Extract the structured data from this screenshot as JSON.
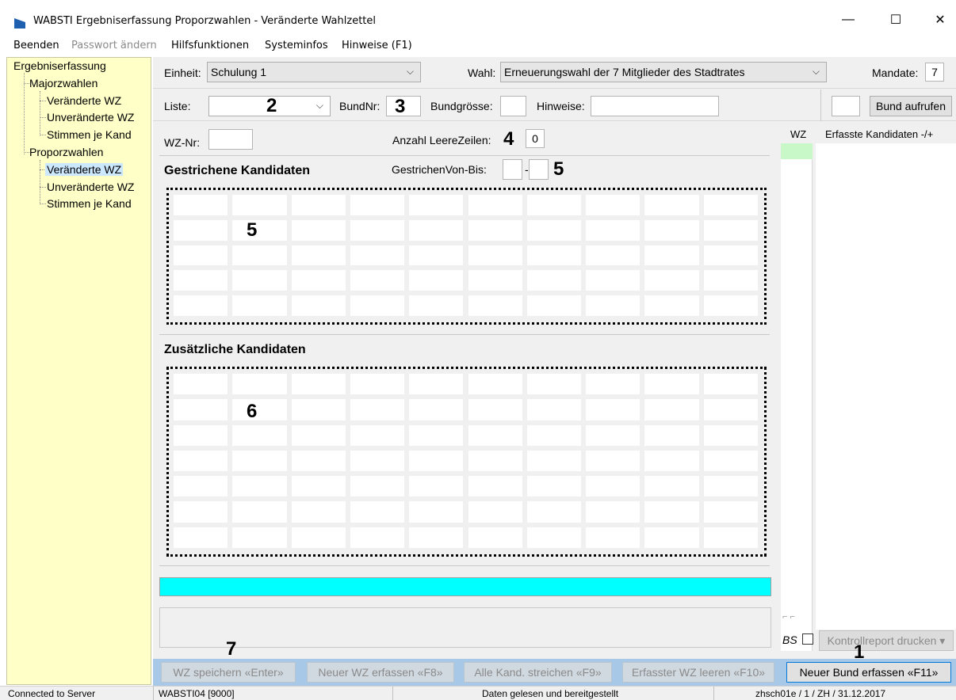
{
  "window": {
    "title": "WABSTI Ergebniserfassung Proporzwahlen - Veränderte Wahlzettel",
    "min_glyph": "—",
    "max_glyph": "☐",
    "close_glyph": "✕"
  },
  "menu": {
    "items": [
      {
        "label": "Beenden",
        "enabled": true
      },
      {
        "label": "Passwort ändern",
        "enabled": false
      },
      {
        "label": "Hilfsfunktionen",
        "enabled": true
      },
      {
        "label": "Systeminfos",
        "enabled": true
      },
      {
        "label": "Hinweise (F1)",
        "enabled": true
      }
    ]
  },
  "tree": {
    "root": "Ergebniserfassung",
    "groups": [
      {
        "label": "Majorzwahlen",
        "children": [
          "Veränderte WZ",
          "Unveränderte WZ",
          "Stimmen je Kand"
        ]
      },
      {
        "label": "Proporzwahlen",
        "children": [
          "Veränderte WZ",
          "Unveränderte WZ",
          "Stimmen je Kand"
        ],
        "selected_index": 0
      }
    ]
  },
  "header": {
    "einheit_label": "Einheit:",
    "einheit_value": "Schulung 1",
    "wahl_label": "Wahl:",
    "wahl_value": "Erneuerungswahl der 7 Mitglieder des Stadtrates",
    "mandate_label": "Mandate:",
    "mandate_value": "7"
  },
  "liste_row": {
    "liste_label": "Liste:",
    "liste_value": "",
    "bundnr_label": "BundNr:",
    "bundgroesse_label": "Bundgrösse:",
    "hinweise_label": "Hinweise:",
    "bund_aufrufen_label": "Bund aufrufen"
  },
  "wz_row": {
    "wznr_label": "WZ-Nr:",
    "anzahl_label": "Anzahl LeereZeilen:",
    "anzahl_value": "0",
    "gestrichen_von_bis_label": "GestrichenVon-Bis:",
    "von_bis_sep": "-"
  },
  "sections": {
    "gestrichene": "Gestrichene Kandidaten",
    "zusaetzliche": "Zusätzliche Kandidaten"
  },
  "annotations": {
    "a1": "1",
    "a2": "2",
    "a3": "3",
    "a4": "4",
    "a5_field": "5",
    "a5_grid": "5",
    "a6": "6",
    "a7": "7"
  },
  "right_panel": {
    "wz_header": "WZ",
    "kand_header": "Erfasste Kandidaten -/+",
    "bs_label": "BS",
    "kontrollreport_label": "Kontrollreport drucken ▾",
    "nav_glyphs": "⌐ ⌐"
  },
  "toolbar": {
    "wz_speichern": "WZ speichern «Enter»",
    "neuer_wz": "Neuer WZ erfassen «F8»",
    "alle_kand": "Alle Kand. streichen «F9»",
    "erfasster_wz": "Erfasster WZ leeren «F10»",
    "neuer_bund": "Neuer Bund erfassen «F11»"
  },
  "status": {
    "connection": "Connected to Server",
    "server": "WABSTI04 [9000]",
    "message": "Daten gelesen und bereitgestellt",
    "context": "zhsch01e / 1 / ZH / 31.12.2017"
  },
  "colors": {
    "tree_bg": "#ffffc8",
    "progress": "#00ffff",
    "toolbar_bg": "#a8c8e8",
    "wz_green": "#c8f7c8"
  }
}
